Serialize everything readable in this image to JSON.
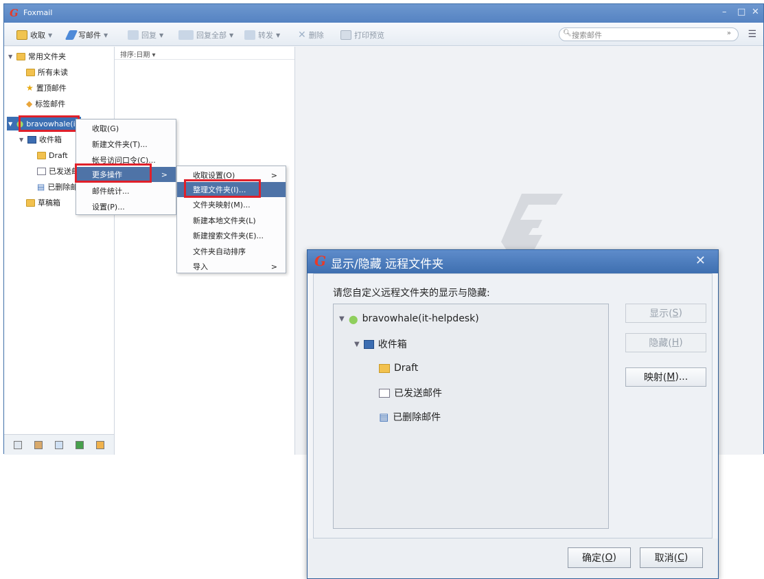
{
  "window": {
    "title": "Foxmail"
  },
  "toolbar": {
    "receive": "收取",
    "compose": "写邮件",
    "reply": "回复",
    "reply_all": "回复全部",
    "forward": "转发",
    "delete": "删除",
    "print_preview": "打印预览",
    "search_placeholder": "搜索邮件"
  },
  "folders": {
    "common": "常用文件夹",
    "all_unread": "所有未读",
    "pinned": "置顶邮件",
    "tagged": "标签邮件",
    "account": "bravowhale(it-",
    "inbox": "收件箱",
    "draft": "Draft",
    "sent": "已发送邮",
    "deleted": "已删除邮",
    "drafts_box": "草稿箱"
  },
  "mail_list": {
    "sort_label": "排序:日期 ▾"
  },
  "context_menu": {
    "items": [
      "收取(G)",
      "新建文件夹(T)...",
      "帐号访问口令(C)...",
      "更多操作",
      "邮件统计...",
      "设置(P)..."
    ]
  },
  "submenu": {
    "items": [
      "收取设置(O)",
      "整理文件夹(I)...",
      "文件夹映射(M)...",
      "新建本地文件夹(L)",
      "新建搜索文件夹(E)...",
      "文件夹自动排序",
      "导入"
    ]
  },
  "dialog": {
    "title": "显示/隐藏 远程文件夹",
    "prompt": "请您自定义远程文件夹的显示与隐藏:",
    "tree": {
      "account": "bravowhale(it-helpdesk)",
      "inbox": "收件箱",
      "draft": "Draft",
      "sent": "已发送邮件",
      "deleted": "已删除邮件"
    },
    "show_button": "显示(",
    "show_key": "S",
    "hide_button": "隐藏(",
    "hide_key": "H",
    "map_button": "映射(",
    "map_key": "M",
    "map_suffix": ")...",
    "ok_button": "确定(",
    "ok_key": "O",
    "cancel_button": "取消(",
    "cancel_key": "C",
    "close_paren": ")"
  },
  "colors": {
    "accent": "#3b6fb3",
    "highlight_box": "#e0202a",
    "logo_red": "#e43b2a"
  }
}
